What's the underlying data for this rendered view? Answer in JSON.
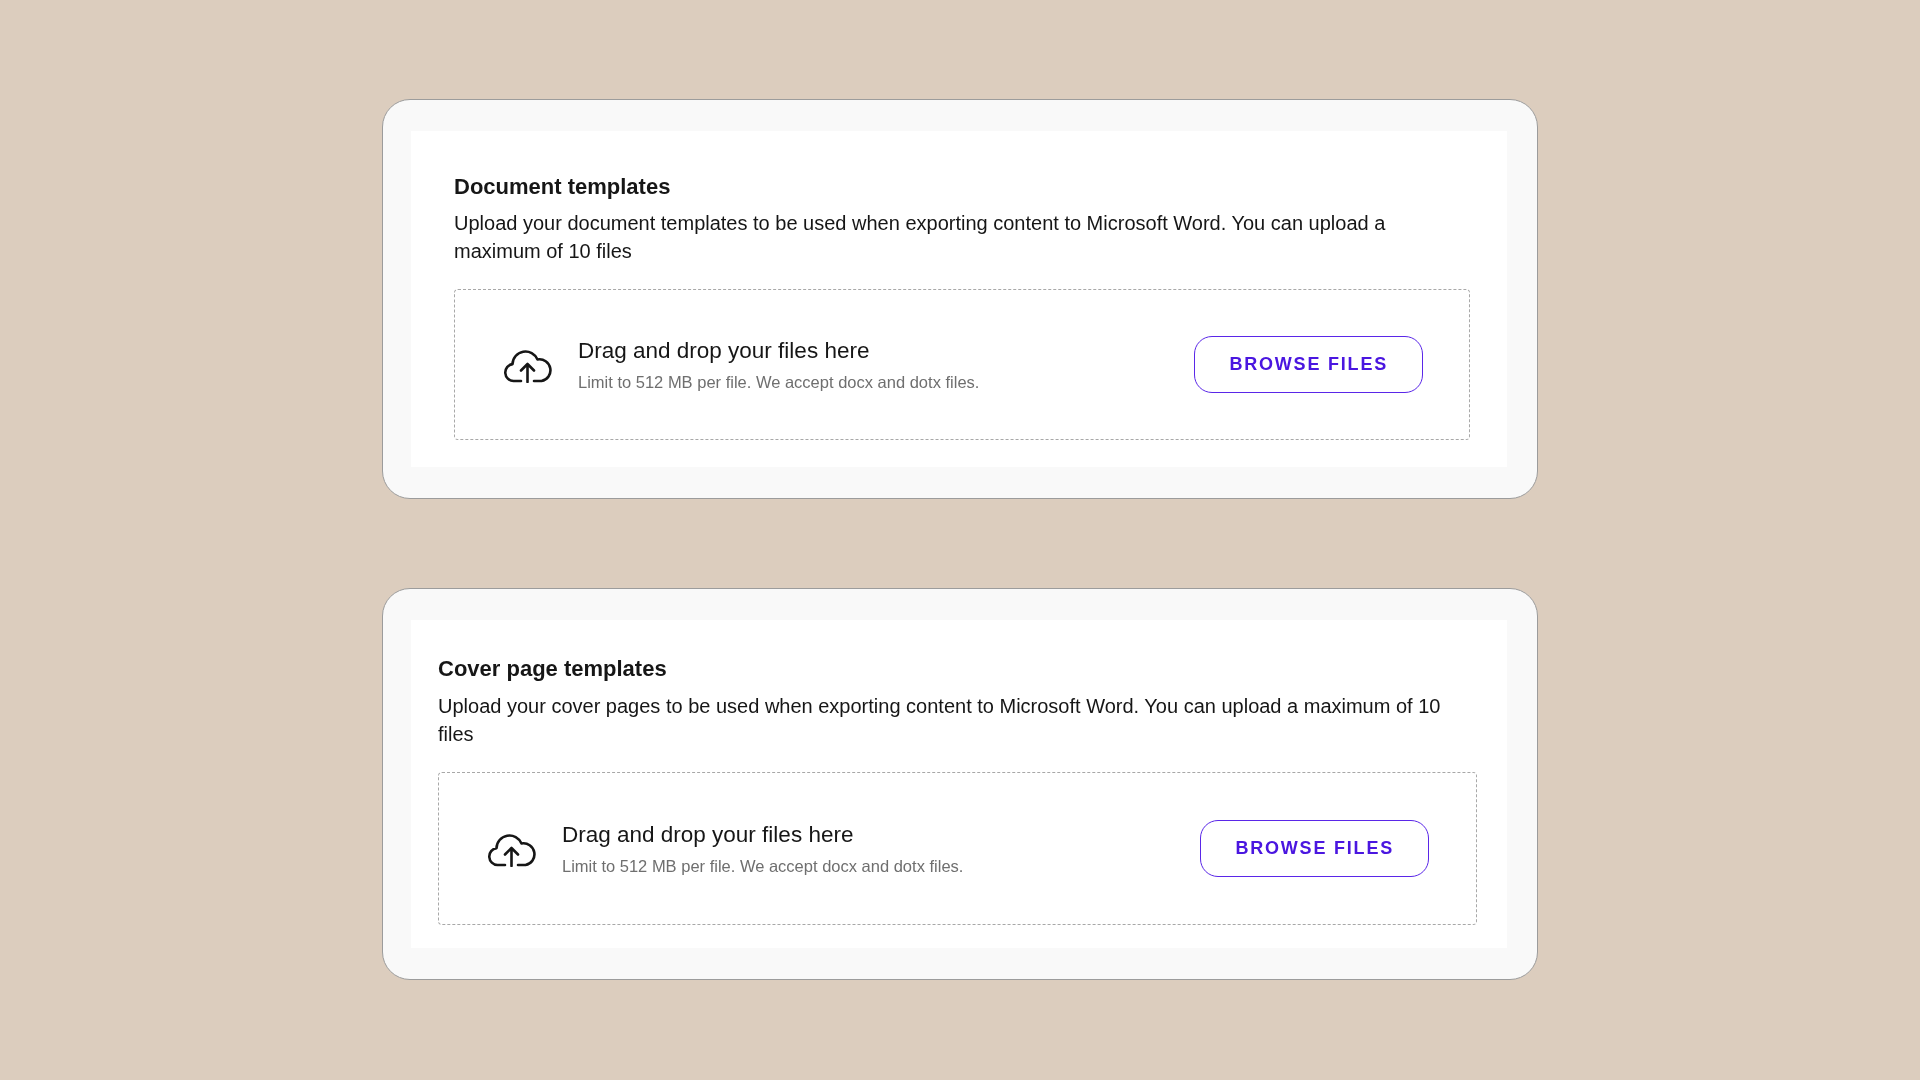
{
  "sections": [
    {
      "title": "Document templates",
      "description": "Upload your document templates to be used when exporting content to Microsoft Word. You can upload a maximum of 10 files",
      "dropzone": {
        "title": "Drag and drop your files here",
        "hint": "Limit to 512 MB per file. We accept docx and dotx files.",
        "button": "BROWSE FILES"
      }
    },
    {
      "title": "Cover page templates",
      "description": "Upload your cover pages to be used when exporting content to Microsoft Word. You can upload a maximum of 10 files",
      "dropzone": {
        "title": "Drag and drop your files here",
        "hint": "Limit to 512 MB per file. We accept docx and dotx files.",
        "button": "BROWSE FILES"
      }
    }
  ]
}
